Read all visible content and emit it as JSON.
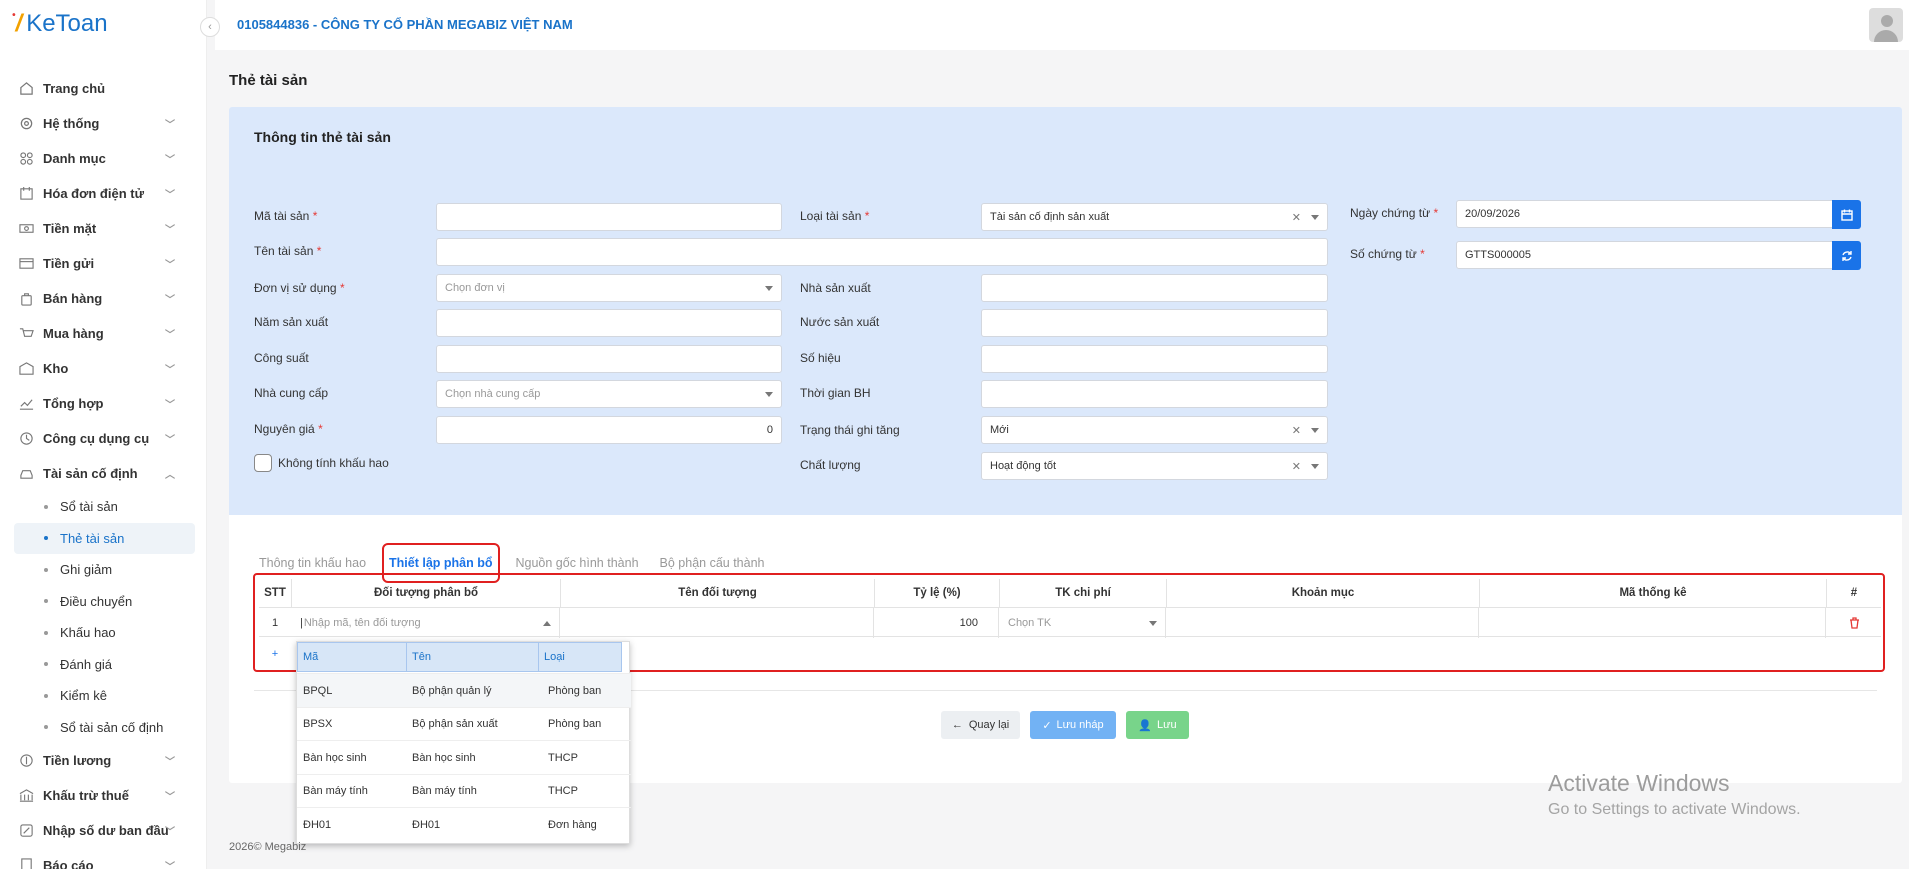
{
  "app": {
    "logo_text": "KeToan"
  },
  "header": {
    "company": "0105844836 - CÔNG TY CỔ PHẦN MEGABIZ VIỆT NAM"
  },
  "sidebar": {
    "items": [
      {
        "label": "Trang chủ",
        "icon": "home-icon"
      },
      {
        "label": "Hệ thống",
        "icon": "gear-icon"
      },
      {
        "label": "Danh mục",
        "icon": "grid-icon"
      },
      {
        "label": "Hóa đơn điện tử",
        "icon": "invoice-icon"
      },
      {
        "label": "Tiền mặt",
        "icon": "cash-icon"
      },
      {
        "label": "Tiền gửi",
        "icon": "bank-card-icon"
      },
      {
        "label": "Bán hàng",
        "icon": "bag-icon"
      },
      {
        "label": "Mua hàng",
        "icon": "cart-icon"
      },
      {
        "label": "Kho",
        "icon": "warehouse-icon"
      },
      {
        "label": "Tổng hợp",
        "icon": "chart-icon"
      },
      {
        "label": "Công cụ dụng cụ",
        "icon": "tools-icon"
      },
      {
        "label": "Tài sản cố định",
        "icon": "car-icon"
      }
    ],
    "sub_items": [
      "Sổ tài sản",
      "Thẻ tài sản",
      "Ghi giảm",
      "Điều chuyển",
      "Khấu hao",
      "Đánh giá",
      "Kiểm kê",
      "Sổ tài sản cố định"
    ],
    "items_after": [
      {
        "label": "Tiền lương",
        "icon": "money-icon"
      },
      {
        "label": "Khấu trừ thuế",
        "icon": "tax-icon"
      },
      {
        "label": "Nhập số dư ban đầu",
        "icon": "edit-icon"
      },
      {
        "label": "Báo cáo",
        "icon": "report-icon"
      }
    ]
  },
  "page": {
    "title": "Thẻ tài sản"
  },
  "form": {
    "title": "Thông tin thẻ tài sản",
    "ma_tai_san": {
      "label": "Mã tài sản",
      "value": ""
    },
    "ten_tai_san": {
      "label": "Tên tài sản",
      "value": ""
    },
    "don_vi_su_dung": {
      "label": "Đơn vị sử dụng",
      "placeholder": "Chọn đơn vị"
    },
    "nam_san_xuat": {
      "label": "Năm sản xuất",
      "value": ""
    },
    "cong_suat": {
      "label": "Công suất",
      "value": ""
    },
    "nha_cung_cap": {
      "label": "Nhà cung cấp",
      "placeholder": "Chọn nhà cung cấp"
    },
    "nguyen_gia": {
      "label": "Nguyên giá",
      "value": "0"
    },
    "khong_tinh_khau_hao": {
      "label": "Không tính khấu hao",
      "checked": false
    },
    "loai_tai_san": {
      "label": "Loại tài sản",
      "value": "Tài sản cố định sản xuất"
    },
    "nha_san_xuat": {
      "label": "Nhà sản xuất",
      "value": ""
    },
    "nuoc_san_xuat": {
      "label": "Nước sản xuất",
      "value": ""
    },
    "so_hieu": {
      "label": "Số hiệu",
      "value": ""
    },
    "thoi_gian_bh": {
      "label": "Thời gian BH",
      "value": ""
    },
    "trang_thai_ghi_tang": {
      "label": "Trạng thái ghi tăng",
      "value": "Mới"
    },
    "chat_luong": {
      "label": "Chất lượng",
      "value": "Hoạt động tốt"
    },
    "ngay_chung_tu": {
      "label": "Ngày chứng từ",
      "value": "20/09/2026"
    },
    "so_chung_tu": {
      "label": "Số chứng từ",
      "value": "GTTS000005"
    }
  },
  "tabs": [
    "Thông tin khấu hao",
    "Thiết lập phân bổ",
    "Nguồn gốc hình thành",
    "Bộ phận cấu thành"
  ],
  "grid": {
    "headers": [
      "STT",
      "Đối tượng phân bổ",
      "Tên đối tượng",
      "Tỷ lệ (%)",
      "TK chi phí",
      "Khoản mục",
      "Mã thống kê",
      "#"
    ],
    "row": {
      "stt": "1",
      "doi_tuong_placeholder": "Nhập mã, tên đối tượng",
      "ty_le": "100",
      "tk_placeholder": "Chọn TK"
    },
    "add_symbol": "+"
  },
  "dropdown": {
    "headers": [
      "Mã",
      "Tên",
      "Loại"
    ],
    "rows": [
      [
        "BPQL",
        "Bộ phận quản lý",
        "Phòng ban"
      ],
      [
        "BPSX",
        "Bộ phận sản xuất",
        "Phòng ban"
      ],
      [
        "Bàn học sinh",
        "Bàn học sinh",
        "THCP"
      ],
      [
        "Bàn máy tính",
        "Bàn máy tính",
        "THCP"
      ],
      [
        "ĐH01",
        "ĐH01",
        "Đơn hàng"
      ]
    ]
  },
  "buttons": {
    "back": "Quay lại",
    "save_draft": "Lưu nháp",
    "save": "Lưu"
  },
  "footer": {
    "text": "2026© Megabiz"
  },
  "watermark": {
    "line1": "Activate Windows",
    "line2": "Go to Settings to activate Windows."
  },
  "colors": {
    "primary": "#1a73e8",
    "panel": "#dbe8fb",
    "highlight_border": "#e02020"
  }
}
